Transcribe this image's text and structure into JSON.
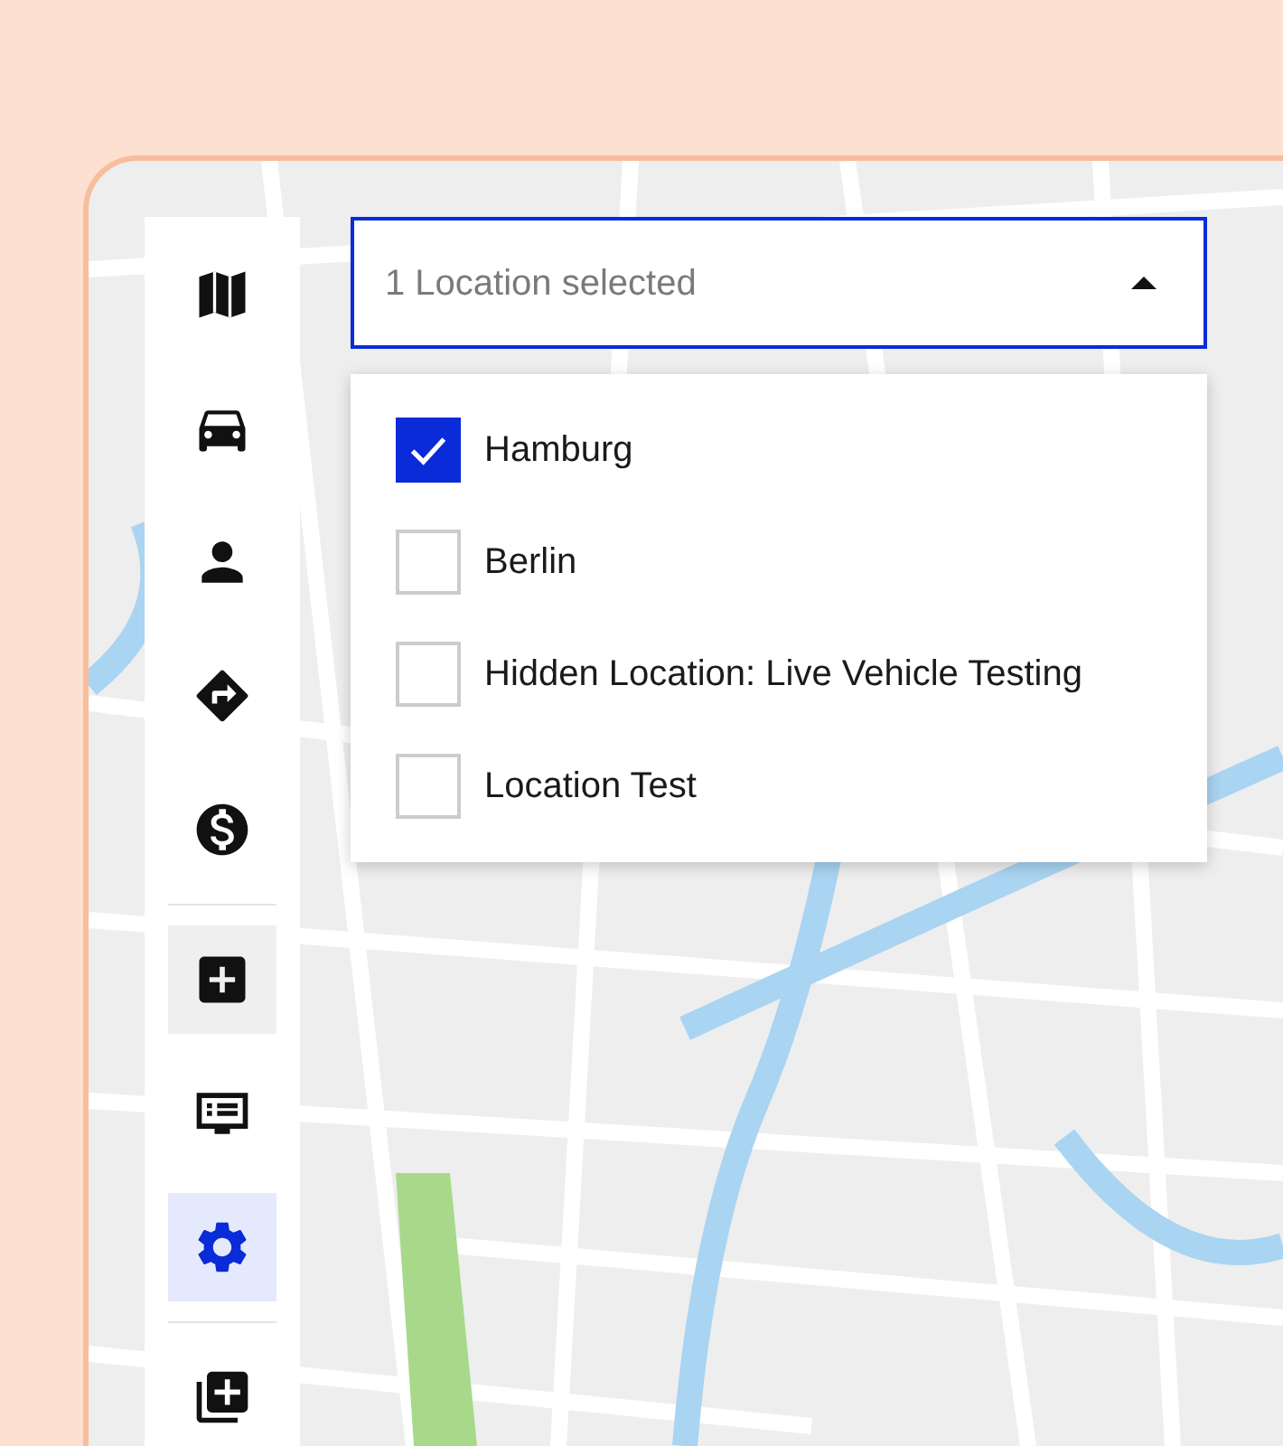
{
  "sidebar": {
    "groups": [
      [
        {
          "selected": false,
          "highlighted": false
        },
        {
          "selected": false,
          "highlighted": false
        },
        {
          "selected": false,
          "highlighted": false
        },
        {
          "selected": false,
          "highlighted": false
        },
        {
          "selected": false,
          "highlighted": false
        }
      ],
      [
        {
          "selected": false,
          "highlighted": true
        },
        {
          "selected": false,
          "highlighted": false
        },
        {
          "selected": true,
          "highlighted": false
        }
      ],
      [
        {
          "selected": false,
          "highlighted": false
        }
      ]
    ]
  },
  "location_select": {
    "placeholder": "1 Location selected",
    "expanded": true,
    "options": [
      {
        "label": "Hamburg",
        "checked": true
      },
      {
        "label": "Berlin",
        "checked": false
      },
      {
        "label": "Hidden Location: Live Vehicle Testing",
        "checked": false
      },
      {
        "label": "Location Test",
        "checked": false
      }
    ]
  }
}
